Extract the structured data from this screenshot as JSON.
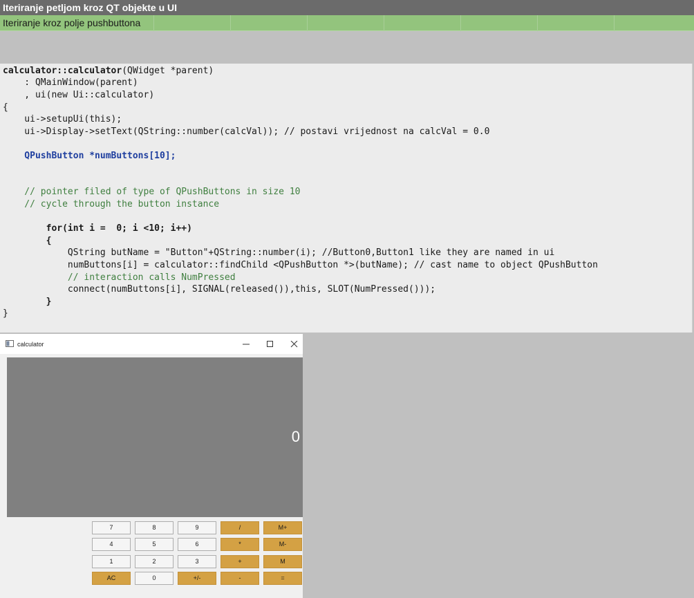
{
  "sheet": {
    "title": "Iteriranje petljom kroz QT objekte u UI",
    "subtitle": "Iteriranje kroz polje pushbuttona"
  },
  "code": {
    "l1a": "calculator::calculator",
    "l1b": "(QWidget *parent)",
    "l2": "    : QMainWindow(parent)",
    "l3": "    , ui(new Ui::calculator)",
    "l4": "{",
    "l5": "    ui->setupUi(this);",
    "l6": "    ui->Display->setText(QString::number(calcVal)); // postavi vrijednost na calcVal = 0.0",
    "l7": "    QPushButton *numButtons[10];",
    "l8": "    // pointer filed of type of QPushButtons in size 10",
    "l9": "    // cycle through the button instance",
    "l10": "        for(int i =  0; i <10; i++)",
    "l11": "        {",
    "l12": "            QString butName = \"Button\"+QString::number(i); //Button0,Button1 like they are named in ui",
    "l13": "            numButtons[i] = calculator::findChild <QPushButton *>(butName); // cast name to object QPushButton",
    "l14": "            // interaction calls NumPressed",
    "l15": "            connect(numButtons[i], SIGNAL(released()),this, SLOT(NumPressed()));",
    "l16": "        }",
    "l17": "}"
  },
  "window": {
    "title": "calculator",
    "display_value": "0",
    "buttons": {
      "b7": "7",
      "b8": "8",
      "b9": "9",
      "div": "/",
      "mplus": "M+",
      "b4": "4",
      "b5": "5",
      "b6": "6",
      "mul": "*",
      "mminus": "M-",
      "b1": "1",
      "b2": "2",
      "b3": "3",
      "add": "+",
      "m": "M",
      "ac": "AC",
      "b0": "0",
      "sign": "+/-",
      "sub": "-",
      "eq": "="
    }
  },
  "colors": {
    "title_bg": "#6b6b6b",
    "subtitle_bg": "#93c47d",
    "code_bg": "#ececec",
    "display_bg": "#808080",
    "op_button": "#d4a144"
  }
}
